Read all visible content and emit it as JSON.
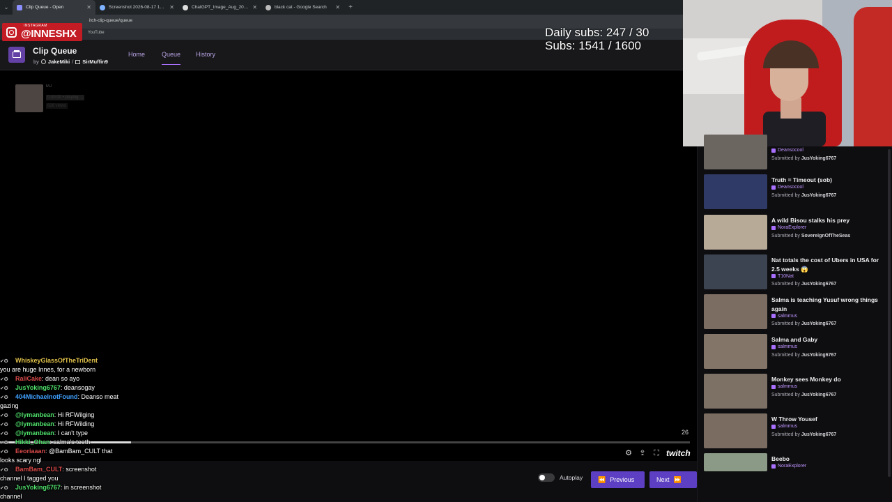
{
  "browser": {
    "tabs": [
      {
        "label": "Clip Queue - Open",
        "active": true
      },
      {
        "label": "Screenshot 2026-08-17 17493...",
        "active": false
      },
      {
        "label": "ChatGPT_Image_Aug_20_2026...",
        "active": false
      },
      {
        "label": "black cat - Google Search",
        "active": false
      }
    ],
    "address": "itch-clip-queue/queue",
    "bookmark": "YouTube"
  },
  "overlay": {
    "instagram_label": "INSTAGRAM",
    "instagram_handle": "@INNESHX",
    "daily_subs": "Daily subs: 247 / 30",
    "subs": "Subs: 1541 / 1600"
  },
  "app": {
    "title": "Clip Queue",
    "by": "by",
    "author1": "JakeMiki",
    "sep": "/",
    "author2": "SirMuffin9",
    "nav": {
      "home": "Home",
      "queue": "Queue",
      "history": "History"
    }
  },
  "player": {
    "ghost": {
      "name": "MJ",
      "line2": "0:00:00 • playing ...",
      "line3": "826 views"
    },
    "time": "26",
    "progress": 0.19,
    "brand": "twitch",
    "autoplay_label": "Autoplay",
    "prev_label": "Previous",
    "next_label": "Next"
  },
  "queue": [
    {
      "title": "",
      "channel": "Deansocool",
      "submitted_prefix": "Submitted by",
      "submitter": "JusYoking6767",
      "thumb": "#6b6660"
    },
    {
      "title": "Truth = Timeout (sob)",
      "channel": "Deansocool",
      "submitted_prefix": "Submitted by",
      "submitter": "JusYoking6767",
      "thumb": "#2f3a66"
    },
    {
      "title": "A wild Bisou stalks his prey",
      "channel": "NoraExplorer",
      "submitted_prefix": "Submitted by",
      "submitter": "SovereignOfTheSeas",
      "thumb": "#b7aa97"
    },
    {
      "title": "Nat totals the cost of Ubers in USA for 2.5 weeks 😱",
      "channel": "T10Nat",
      "submitted_prefix": "Submitted by",
      "submitter": "JusYoking6767",
      "thumb": "#3c4452"
    },
    {
      "title": "Salma is teaching Yusuf wrong things again",
      "channel": "salmmus",
      "submitted_prefix": "Submitted by",
      "submitter": "JusYoking6767",
      "thumb": "#7c6d62"
    },
    {
      "title": "Salma and Gaby",
      "channel": "salmmus",
      "submitted_prefix": "Submitted by",
      "submitter": "JusYoking6767",
      "thumb": "#837567"
    },
    {
      "title": "Monkey sees Monkey do",
      "channel": "salmmus",
      "submitted_prefix": "Submitted by",
      "submitter": "JusYoking6767",
      "thumb": "#7d7064"
    },
    {
      "title": "W Throw Yousef",
      "channel": "salmmus",
      "submitted_prefix": "Submitted by",
      "submitter": "JusYoking6767",
      "thumb": "#7a6c61"
    },
    {
      "title": "Beebo",
      "channel": "NoraExplorer",
      "submitted_prefix": "",
      "submitter": "",
      "thumb": "#8a9a86"
    }
  ],
  "chat": [
    {
      "user": "WhiskeyGlassOfTheTriDent",
      "color": "#e0c14a",
      "text": ""
    },
    {
      "user": "",
      "color": "#ffffff",
      "text": "you are huge Innes, for a newborn"
    },
    {
      "user": "RaliCake",
      "color": "#d94a4a",
      "text": ": dean so ayo"
    },
    {
      "user": "JusYoking6767",
      "color": "#4fe06b",
      "text": ": deansogay"
    },
    {
      "user": "404MichaelnotFound",
      "color": "#3fa0ff",
      "text": ": Deanso meat"
    },
    {
      "user": "",
      "color": "#ffffff",
      "text": "gazing"
    },
    {
      "user": "@lymanbean",
      "color": "#4fe06b",
      "text": ": Hi RFWilging"
    },
    {
      "user": "@lymanbean",
      "color": "#4fe06b",
      "text": ": Hi RFWilding"
    },
    {
      "user": "@lymanbean",
      "color": "#4fe06b",
      "text": ": I can't type"
    },
    {
      "user": "Hikki_Ohan",
      "color": "#4fe06b",
      "text": ": salma's teeth"
    },
    {
      "user": "Eeoriaaan",
      "color": "#d94a4a",
      "text": ": @BamBam_CULT that"
    },
    {
      "user": "",
      "color": "#ffffff",
      "text": "looks scary ngl"
    },
    {
      "user": "BamBam_CULT",
      "color": "#d94a4a",
      "text": ": screenshot"
    },
    {
      "user": "",
      "color": "#ffffff",
      "text": "channel I tagged you"
    },
    {
      "user": "JusYoking6767",
      "color": "#4fe06b",
      "text": ": in screenshot"
    },
    {
      "user": "",
      "color": "#ffffff",
      "text": "channel"
    }
  ]
}
